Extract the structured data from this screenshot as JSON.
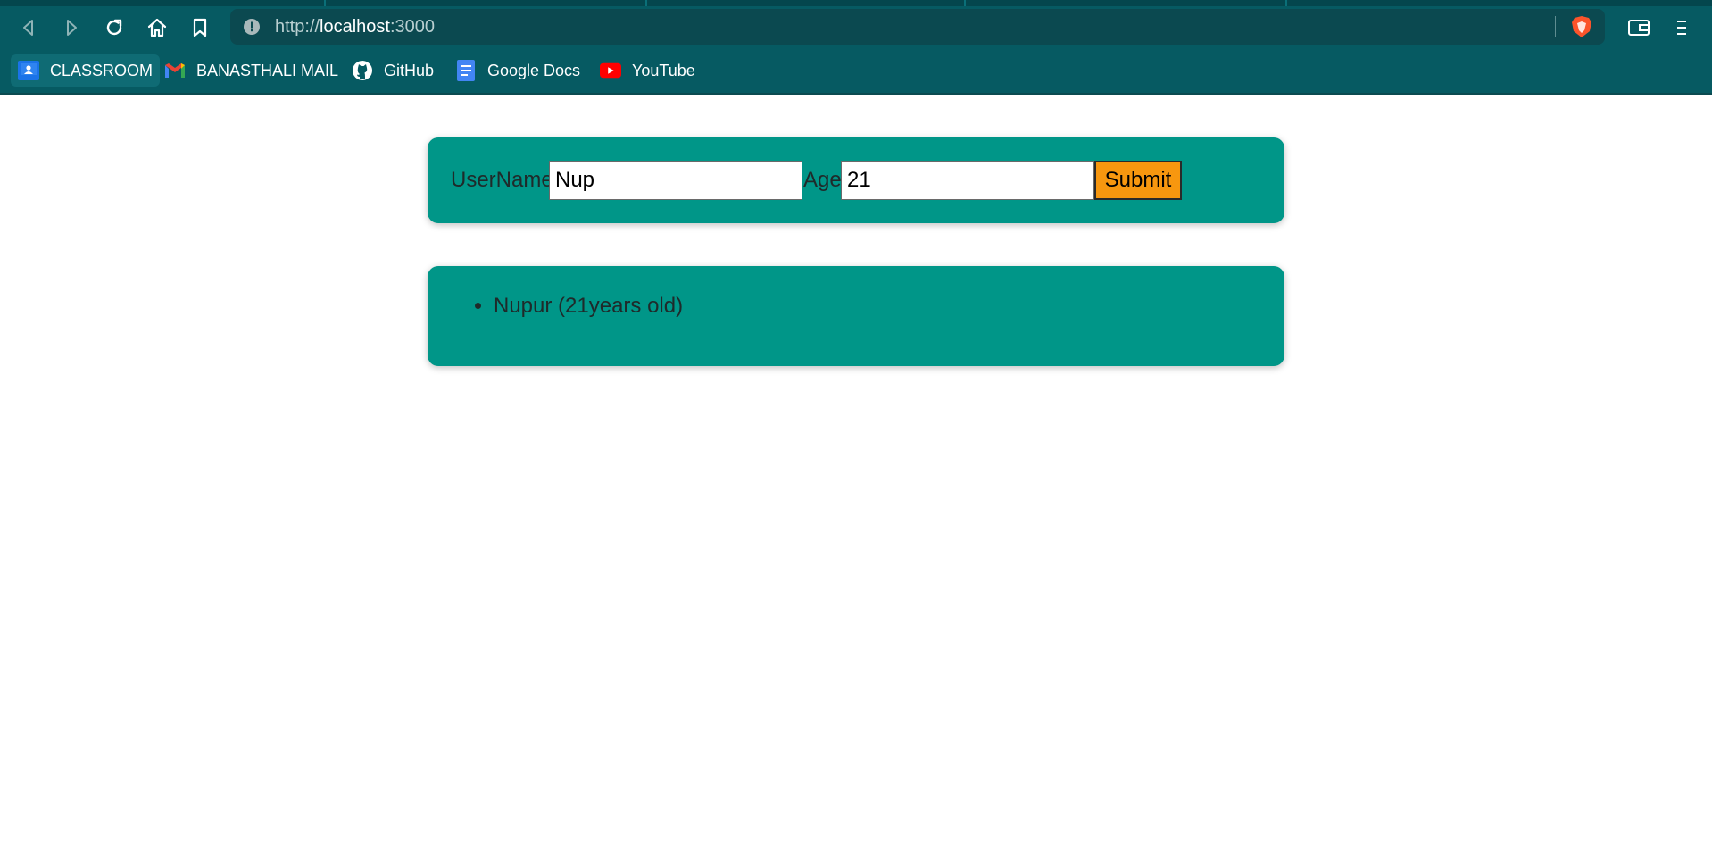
{
  "browser": {
    "url_scheme": "http://",
    "url_host": "localhost",
    "url_port": ":3000",
    "bookmarks": [
      {
        "label": "CLASSROOM",
        "icon": "classroom-icon"
      },
      {
        "label": "BANASTHALI MAIL",
        "icon": "gmail-icon"
      },
      {
        "label": "GitHub",
        "icon": "github-icon"
      },
      {
        "label": "Google Docs",
        "icon": "google-docs-icon"
      },
      {
        "label": "YouTube",
        "icon": "youtube-icon"
      }
    ],
    "colors": {
      "toolbar": "#065a62",
      "urlbar": "#0b4950"
    }
  },
  "form": {
    "username_label": "UserName",
    "username_value": "Nup",
    "age_label": "Age",
    "age_value": "21",
    "submit_label": "Submit",
    "colors": {
      "card": "#009688",
      "submit": "#f7970f"
    }
  },
  "users": [
    {
      "text": "Nupur (21years old)"
    }
  ]
}
